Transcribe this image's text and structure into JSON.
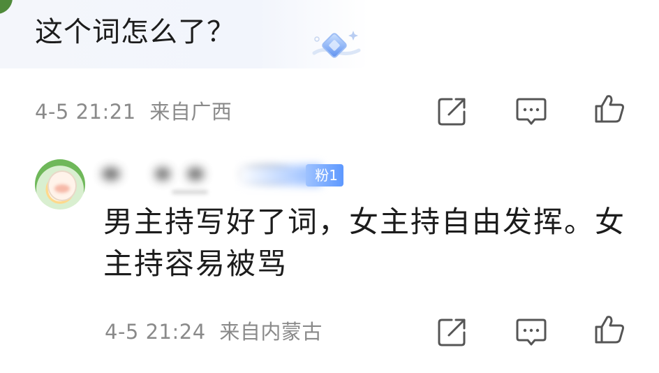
{
  "comment1": {
    "text": "这个词怎么了？",
    "timestamp": "4-5 21:21",
    "location": "来自广西",
    "actions": {
      "share_icon": "share-icon",
      "comment_icon": "comment-icon",
      "like_icon": "thumbs-up-icon"
    }
  },
  "comment2": {
    "badge": "粉1",
    "text": "男主持写好了词，女主持自由发挥。女主持容易被骂",
    "timestamp": "4-5 21:24",
    "location": "来自内蒙古",
    "actions": {
      "share_icon": "share-icon",
      "comment_icon": "comment-icon",
      "like_icon": "thumbs-up-icon"
    }
  },
  "colors": {
    "meta_gray": "#8a8a8a",
    "badge_blue": "#5d98ff",
    "bubble_bg": "#f3f5fb"
  }
}
